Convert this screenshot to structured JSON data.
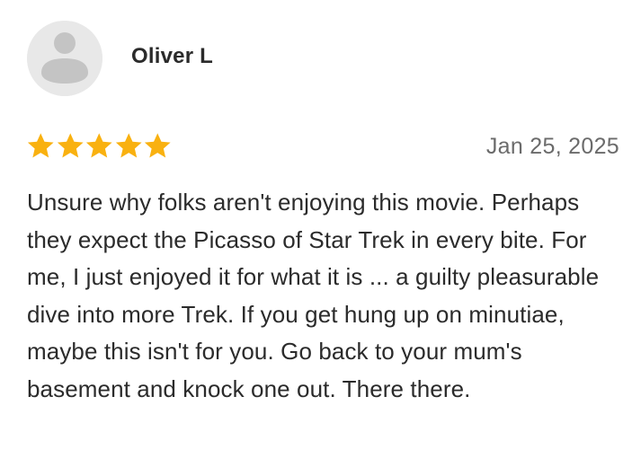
{
  "review": {
    "author": {
      "name": "Oliver L",
      "avatar_icon": "default-user-avatar-icon"
    },
    "rating": {
      "value": 5,
      "max": 5,
      "star_color": "#f9b110"
    },
    "date": "Jan 25, 2025",
    "body": "Unsure why folks aren't enjoying this movie. Perhaps they expect the Picasso of Star Trek in every bite. For me, I just enjoyed it for what it is ... a guilty pleasurable dive into more Trek. If you get hung up on minutiae, maybe this isn't for you. Go back to your mum's basement and knock one out. There there."
  }
}
